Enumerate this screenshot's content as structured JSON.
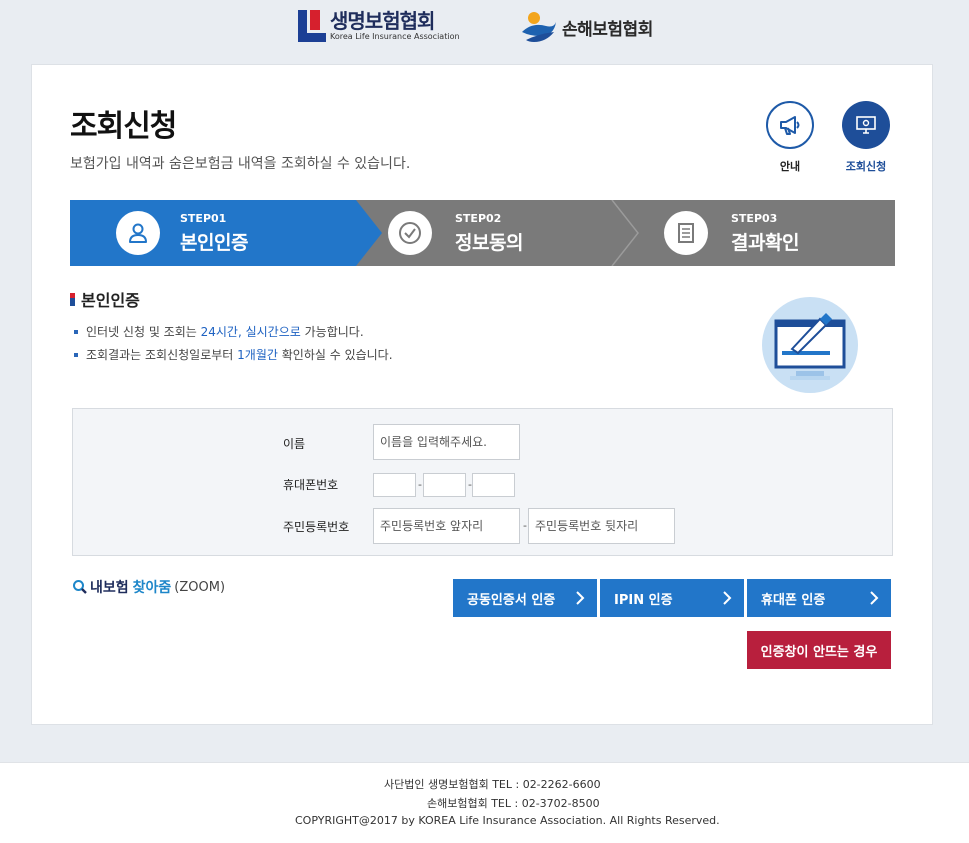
{
  "header": {
    "logo_life_ko": "생명보험협회",
    "logo_life_en": "Korea Life Insurance Association",
    "logo_damage_ko": "손해보험협회"
  },
  "page": {
    "title": "조회신청",
    "description": "보험가입 내역과 숨은보험금 내역을 조회하실 수 있습니다."
  },
  "quick_links": [
    {
      "label": "안내",
      "icon": "megaphone-icon"
    },
    {
      "label": "조회신청",
      "icon": "monitor-search-icon"
    }
  ],
  "steps": [
    {
      "no": "STEP01",
      "name": "본인인증",
      "icon": "user-icon",
      "active": true
    },
    {
      "no": "STEP02",
      "name": "정보동의",
      "icon": "check-circle-icon",
      "active": false
    },
    {
      "no": "STEP03",
      "name": "결과확인",
      "icon": "document-icon",
      "active": false
    }
  ],
  "section": {
    "title": "본인인증",
    "bullet1": {
      "pre": "인터넷 신청 및 조회는 ",
      "hl": "24시간, 실시간으로",
      "post": " 가능합니다."
    },
    "bullet2": {
      "pre": "조회결과는 조회신청일로부터 ",
      "hl": "1개월간",
      "post": " 확인하실 수 있습니다."
    }
  },
  "form": {
    "name_label": "이름",
    "name_placeholder": "이름을 입력해주세요.",
    "phone_label": "휴대폰번호",
    "phone_sep": "-",
    "rrn_label": "주민등록번호",
    "rrn_front_placeholder": "주민등록번호 앞자리",
    "rrn_back_placeholder": "주민등록번호 뒷자리",
    "rrn_sep": "-"
  },
  "zoom": {
    "a": "내보험",
    "b": "찾아줌",
    "c": "(ZOOM)"
  },
  "buttons": {
    "cert": "공동인증서 인증",
    "ipin": "IPIN 인증",
    "phone": "휴대폰 인증",
    "popup_help": "인증창이 안뜨는 경우"
  },
  "footer": {
    "line1": "사단법인 생명보험협회 TEL : 02-2262-6600",
    "line2": "손해보험협회 TEL : 02-3702-8500",
    "line3": "COPYRIGHT@2017 by KOREA Life Insurance Association. All Rights Reserved."
  },
  "colors": {
    "primary": "#2276c9",
    "navy": "#1e4e99",
    "step_inactive": "#7a7a7a",
    "danger": "#b81f3d"
  }
}
